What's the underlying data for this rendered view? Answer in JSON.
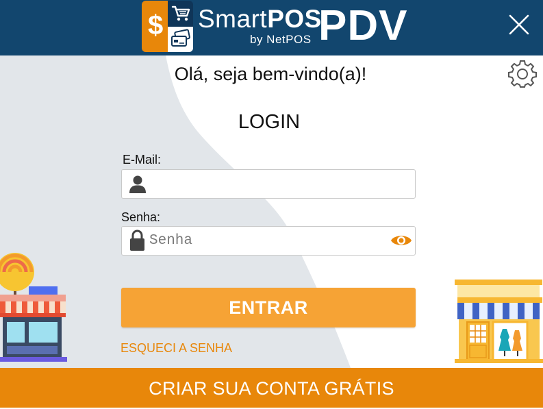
{
  "header": {
    "brand_smart": "Smart",
    "brand_pos": "POS",
    "brand_by": "by NetPOS",
    "brand_pdv": "PDV",
    "dollar_glyph": "$",
    "close_icon": "close-icon"
  },
  "welcome": "Olá, seja bem-vindo(a)!",
  "settings_icon": "gear-icon",
  "login_title": "LOGIN",
  "email": {
    "label": "E-Mail:",
    "value": "",
    "placeholder": "",
    "icon": "user-icon"
  },
  "password": {
    "label": "Senha:",
    "value": "",
    "placeholder": "Senha",
    "icon": "lock-icon",
    "toggle_icon": "eye-icon"
  },
  "submit_label": "ENTRAR",
  "forgot_label": "ESQUECI A SENHA",
  "footer_label": "CRIAR SUA CONTA GRÁTIS",
  "colors": {
    "header_bg": "#12466e",
    "accent_orange": "#e8870a",
    "button_orange": "#f6a335",
    "shape_gray": "#e2e6ea"
  }
}
